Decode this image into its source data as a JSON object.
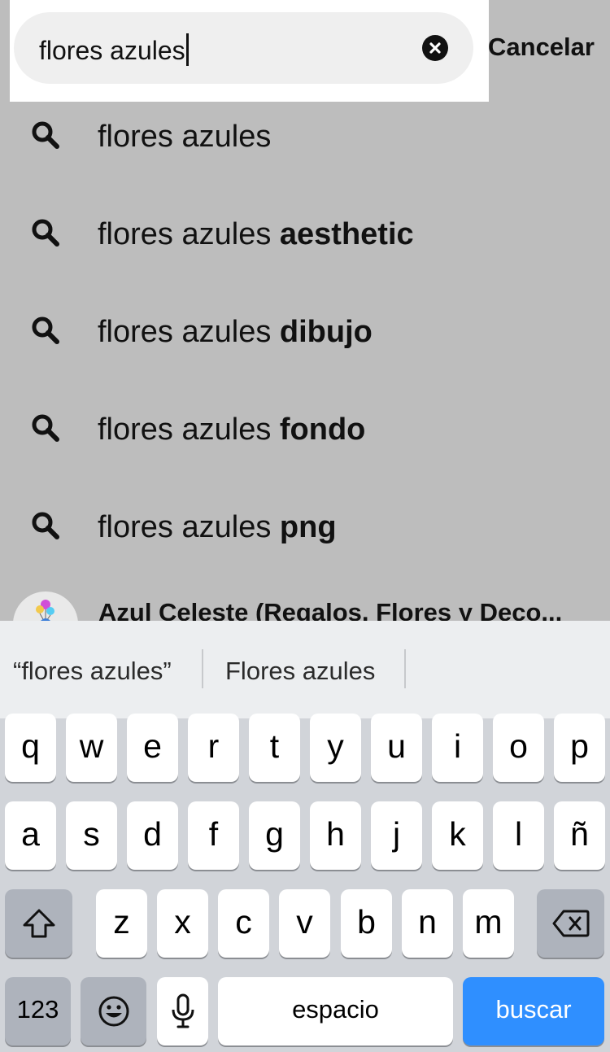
{
  "search": {
    "query": "flores azules",
    "cancel_label": "Cancelar"
  },
  "suggestions": [
    {
      "prefix": "flores azules",
      "suffix": ""
    },
    {
      "prefix": "flores azules ",
      "suffix": "aesthetic"
    },
    {
      "prefix": "flores azules ",
      "suffix": "dibujo"
    },
    {
      "prefix": "flores azules ",
      "suffix": "fondo"
    },
    {
      "prefix": "flores azules ",
      "suffix": "png"
    }
  ],
  "account": {
    "name": "Azul Celeste (Regalos, Flores y Deco..."
  },
  "keyboard": {
    "predictions": [
      "“flores azules”",
      "Flores azules"
    ],
    "row1": [
      "q",
      "w",
      "e",
      "r",
      "t",
      "y",
      "u",
      "i",
      "o",
      "p"
    ],
    "row2": [
      "a",
      "s",
      "d",
      "f",
      "g",
      "h",
      "j",
      "k",
      "l",
      "ñ"
    ],
    "row3": [
      "z",
      "x",
      "c",
      "v",
      "b",
      "n",
      "m"
    ],
    "numbers_label": "123",
    "space_label": "espacio",
    "return_label": "buscar"
  },
  "colors": {
    "accent": "#2f8fff",
    "overlay": "#bdbdbd"
  }
}
